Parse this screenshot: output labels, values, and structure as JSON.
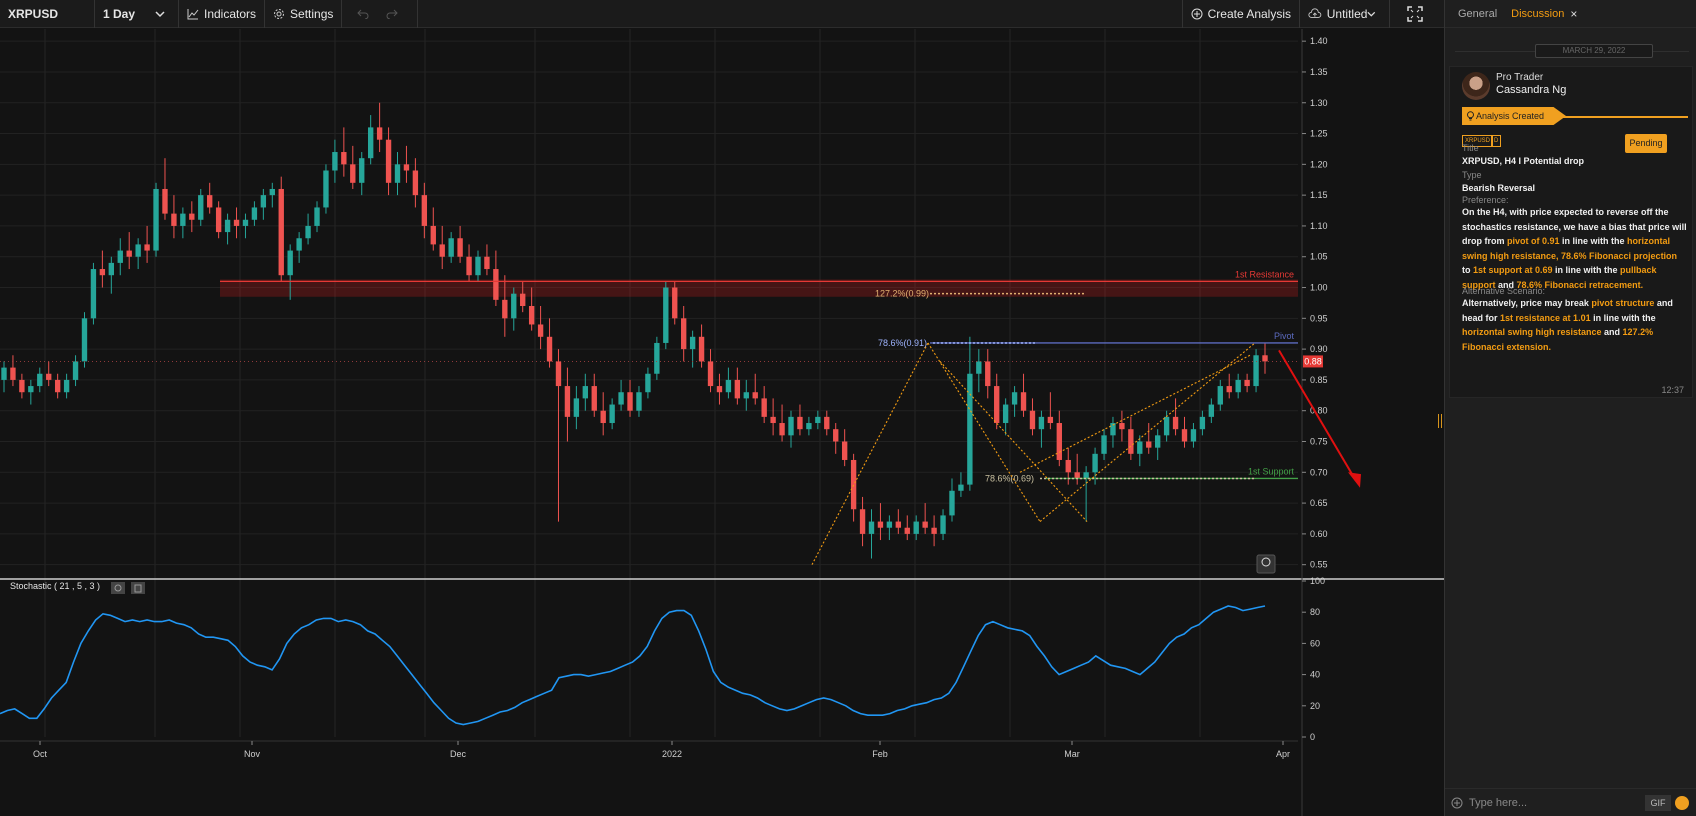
{
  "toolbar": {
    "symbol": "XRPUSD",
    "interval": "1 Day",
    "indicators_label": "Indicators",
    "settings_label": "Settings",
    "create_analysis_label": "Create Analysis",
    "layout_name": "Untitled"
  },
  "panel": {
    "tabs": [
      "General",
      "Discussion"
    ],
    "active_tab": "Discussion",
    "date_separator": "MARCH 29, 2022",
    "message": {
      "role": "Pro Trader",
      "author": "Cassandra Ng",
      "status": "Analysis Created",
      "tags": [
        "XRPUSD",
        "D"
      ],
      "badge": "Pending",
      "title_label": "Title",
      "title": "XRPUSD, H4 I Potential drop",
      "type_label": "Type",
      "type": "Bearish Reversal",
      "preference_label": "Preference:",
      "preference": [
        {
          "t": "On the H4, with price expected to reverse off the stochastics resistance, we have a bias that price will drop from ",
          "h": false
        },
        {
          "t": "pivot of 0.91",
          "h": true
        },
        {
          "t": " in line with the ",
          "h": false
        },
        {
          "t": "horizontal swing high resistance, 78.6% Fibonacci projection",
          "h": true
        },
        {
          "t": " to ",
          "h": false
        },
        {
          "t": "1st support at 0.69",
          "h": true
        },
        {
          "t": " in line with the ",
          "h": false
        },
        {
          "t": "pullback support",
          "h": true
        },
        {
          "t": " and ",
          "h": false
        },
        {
          "t": "78.6% Fibonacci retracement.",
          "h": true
        }
      ],
      "alternative_label": "Alternative Scenario:",
      "alternative": [
        {
          "t": "Alternatively, price may break ",
          "h": false
        },
        {
          "t": "pivot structure",
          "h": true
        },
        {
          "t": " and head for ",
          "h": false
        },
        {
          "t": "1st resistance at 1.01",
          "h": true
        },
        {
          "t": " in line with the ",
          "h": false
        },
        {
          "t": "horizontal swing high resistance",
          "h": true
        },
        {
          "t": " and ",
          "h": false
        },
        {
          "t": "127.2% Fibonacci extension.",
          "h": true
        }
      ],
      "time": "12:37"
    },
    "input_placeholder": "Type here...",
    "gif_label": "GIF"
  },
  "chart_data": [
    {
      "type": "candlestick",
      "symbol": "XRPUSD",
      "ylim": [
        0.53,
        1.41
      ],
      "yticks": [
        1.4,
        1.35,
        1.3,
        1.25,
        1.2,
        1.15,
        1.1,
        1.05,
        1.0,
        0.95,
        0.9,
        0.85,
        0.8,
        0.75,
        0.7,
        0.65,
        0.6,
        0.55
      ],
      "xticks": [
        "Oct",
        "Nov",
        "Dec",
        "2022",
        "Feb",
        "Mar",
        "Apr"
      ],
      "current_price": "0.88",
      "levels": [
        {
          "name": "1st Resistance",
          "value": 1.01,
          "color": "#e53935"
        },
        {
          "name": "Pivot",
          "value": 0.91,
          "color": "#5c6bc0"
        },
        {
          "name": "1st Support",
          "value": 0.69,
          "color": "#43a047"
        }
      ],
      "fib_labels": [
        {
          "text": "127.2%(0.99)",
          "value": 0.99
        },
        {
          "text": "78.6%(0.91)",
          "value": 0.91
        },
        {
          "text": "78.6%(0.69)",
          "value": 0.69
        }
      ],
      "candles": [
        [
          0.85,
          0.88,
          0.83,
          0.87
        ],
        [
          0.87,
          0.89,
          0.84,
          0.85
        ],
        [
          0.85,
          0.86,
          0.82,
          0.83
        ],
        [
          0.83,
          0.85,
          0.81,
          0.84
        ],
        [
          0.84,
          0.87,
          0.83,
          0.86
        ],
        [
          0.86,
          0.88,
          0.84,
          0.85
        ],
        [
          0.85,
          0.86,
          0.82,
          0.83
        ],
        [
          0.83,
          0.86,
          0.82,
          0.85
        ],
        [
          0.85,
          0.89,
          0.84,
          0.88
        ],
        [
          0.88,
          0.96,
          0.87,
          0.95
        ],
        [
          0.95,
          1.04,
          0.94,
          1.03
        ],
        [
          1.03,
          1.06,
          1.0,
          1.02
        ],
        [
          1.02,
          1.05,
          0.99,
          1.04
        ],
        [
          1.04,
          1.08,
          1.02,
          1.06
        ],
        [
          1.06,
          1.09,
          1.03,
          1.05
        ],
        [
          1.05,
          1.08,
          1.03,
          1.07
        ],
        [
          1.07,
          1.1,
          1.04,
          1.06
        ],
        [
          1.06,
          1.17,
          1.05,
          1.16
        ],
        [
          1.16,
          1.21,
          1.11,
          1.12
        ],
        [
          1.12,
          1.15,
          1.08,
          1.1
        ],
        [
          1.1,
          1.13,
          1.08,
          1.12
        ],
        [
          1.12,
          1.14,
          1.09,
          1.11
        ],
        [
          1.11,
          1.16,
          1.1,
          1.15
        ],
        [
          1.15,
          1.17,
          1.12,
          1.13
        ],
        [
          1.13,
          1.14,
          1.08,
          1.09
        ],
        [
          1.09,
          1.12,
          1.07,
          1.11
        ],
        [
          1.11,
          1.13,
          1.08,
          1.1
        ],
        [
          1.1,
          1.12,
          1.08,
          1.11
        ],
        [
          1.11,
          1.14,
          1.1,
          1.13
        ],
        [
          1.13,
          1.16,
          1.11,
          1.15
        ],
        [
          1.15,
          1.17,
          1.13,
          1.16
        ],
        [
          1.16,
          1.18,
          1.01,
          1.02
        ],
        [
          1.02,
          1.07,
          0.98,
          1.06
        ],
        [
          1.06,
          1.09,
          1.04,
          1.08
        ],
        [
          1.08,
          1.12,
          1.07,
          1.1
        ],
        [
          1.1,
          1.14,
          1.09,
          1.13
        ],
        [
          1.13,
          1.2,
          1.12,
          1.19
        ],
        [
          1.19,
          1.24,
          1.17,
          1.22
        ],
        [
          1.22,
          1.26,
          1.18,
          1.2
        ],
        [
          1.2,
          1.23,
          1.16,
          1.17
        ],
        [
          1.17,
          1.22,
          1.15,
          1.21
        ],
        [
          1.21,
          1.28,
          1.2,
          1.26
        ],
        [
          1.26,
          1.3,
          1.22,
          1.24
        ],
        [
          1.24,
          1.26,
          1.15,
          1.17
        ],
        [
          1.17,
          1.22,
          1.15,
          1.2
        ],
        [
          1.2,
          1.23,
          1.17,
          1.19
        ],
        [
          1.19,
          1.21,
          1.13,
          1.15
        ],
        [
          1.15,
          1.17,
          1.08,
          1.1
        ],
        [
          1.1,
          1.13,
          1.06,
          1.07
        ],
        [
          1.07,
          1.1,
          1.03,
          1.05
        ],
        [
          1.05,
          1.09,
          1.04,
          1.08
        ],
        [
          1.08,
          1.1,
          1.04,
          1.05
        ],
        [
          1.05,
          1.07,
          1.01,
          1.02
        ],
        [
          1.02,
          1.06,
          1.01,
          1.05
        ],
        [
          1.05,
          1.07,
          1.02,
          1.03
        ],
        [
          1.03,
          1.06,
          0.97,
          0.98
        ],
        [
          0.98,
          1.02,
          0.92,
          0.95
        ],
        [
          0.95,
          1.0,
          0.93,
          0.99
        ],
        [
          0.99,
          1.01,
          0.96,
          0.97
        ],
        [
          0.97,
          1.0,
          0.93,
          0.94
        ],
        [
          0.94,
          0.97,
          0.9,
          0.92
        ],
        [
          0.92,
          0.95,
          0.87,
          0.88
        ],
        [
          0.88,
          0.9,
          0.62,
          0.84
        ],
        [
          0.84,
          0.87,
          0.75,
          0.79
        ],
        [
          0.79,
          0.84,
          0.77,
          0.82
        ],
        [
          0.82,
          0.86,
          0.8,
          0.84
        ],
        [
          0.84,
          0.86,
          0.79,
          0.8
        ],
        [
          0.8,
          0.83,
          0.76,
          0.78
        ],
        [
          0.78,
          0.82,
          0.77,
          0.81
        ],
        [
          0.81,
          0.85,
          0.8,
          0.83
        ],
        [
          0.83,
          0.85,
          0.79,
          0.8
        ],
        [
          0.8,
          0.84,
          0.79,
          0.83
        ],
        [
          0.83,
          0.87,
          0.82,
          0.86
        ],
        [
          0.86,
          0.92,
          0.85,
          0.91
        ],
        [
          0.91,
          1.01,
          0.9,
          1.0
        ],
        [
          1.0,
          1.01,
          0.94,
          0.95
        ],
        [
          0.95,
          0.97,
          0.88,
          0.9
        ],
        [
          0.9,
          0.93,
          0.87,
          0.92
        ],
        [
          0.92,
          0.94,
          0.87,
          0.88
        ],
        [
          0.88,
          0.9,
          0.83,
          0.84
        ],
        [
          0.84,
          0.86,
          0.81,
          0.83
        ],
        [
          0.83,
          0.87,
          0.82,
          0.85
        ],
        [
          0.85,
          0.87,
          0.81,
          0.82
        ],
        [
          0.82,
          0.85,
          0.8,
          0.83
        ],
        [
          0.83,
          0.86,
          0.81,
          0.82
        ],
        [
          0.82,
          0.84,
          0.78,
          0.79
        ],
        [
          0.79,
          0.82,
          0.76,
          0.78
        ],
        [
          0.78,
          0.81,
          0.75,
          0.76
        ],
        [
          0.76,
          0.8,
          0.74,
          0.79
        ],
        [
          0.79,
          0.81,
          0.76,
          0.77
        ],
        [
          0.77,
          0.79,
          0.76,
          0.78
        ],
        [
          0.78,
          0.8,
          0.77,
          0.79
        ],
        [
          0.79,
          0.8,
          0.76,
          0.77
        ],
        [
          0.77,
          0.78,
          0.73,
          0.75
        ],
        [
          0.75,
          0.77,
          0.71,
          0.72
        ],
        [
          0.72,
          0.73,
          0.62,
          0.64
        ],
        [
          0.64,
          0.66,
          0.58,
          0.6
        ],
        [
          0.6,
          0.64,
          0.56,
          0.62
        ],
        [
          0.62,
          0.65,
          0.59,
          0.61
        ],
        [
          0.61,
          0.63,
          0.59,
          0.62
        ],
        [
          0.62,
          0.64,
          0.6,
          0.61
        ],
        [
          0.61,
          0.63,
          0.59,
          0.6
        ],
        [
          0.6,
          0.63,
          0.59,
          0.62
        ],
        [
          0.62,
          0.65,
          0.6,
          0.61
        ],
        [
          0.61,
          0.63,
          0.58,
          0.6
        ],
        [
          0.6,
          0.64,
          0.59,
          0.63
        ],
        [
          0.63,
          0.69,
          0.62,
          0.67
        ],
        [
          0.67,
          0.7,
          0.66,
          0.68
        ],
        [
          0.68,
          0.92,
          0.67,
          0.86
        ],
        [
          0.86,
          0.9,
          0.83,
          0.88
        ],
        [
          0.88,
          0.9,
          0.82,
          0.84
        ],
        [
          0.84,
          0.86,
          0.77,
          0.78
        ],
        [
          0.78,
          0.82,
          0.76,
          0.81
        ],
        [
          0.81,
          0.84,
          0.79,
          0.83
        ],
        [
          0.83,
          0.86,
          0.79,
          0.8
        ],
        [
          0.8,
          0.82,
          0.76,
          0.77
        ],
        [
          0.77,
          0.8,
          0.74,
          0.79
        ],
        [
          0.79,
          0.83,
          0.77,
          0.78
        ],
        [
          0.78,
          0.8,
          0.71,
          0.72
        ],
        [
          0.72,
          0.74,
          0.68,
          0.7
        ],
        [
          0.7,
          0.73,
          0.68,
          0.69
        ],
        [
          0.69,
          0.71,
          0.62,
          0.7
        ],
        [
          0.7,
          0.74,
          0.68,
          0.73
        ],
        [
          0.73,
          0.77,
          0.72,
          0.76
        ],
        [
          0.76,
          0.79,
          0.74,
          0.78
        ],
        [
          0.78,
          0.8,
          0.75,
          0.77
        ],
        [
          0.77,
          0.79,
          0.72,
          0.73
        ],
        [
          0.73,
          0.76,
          0.71,
          0.75
        ],
        [
          0.75,
          0.78,
          0.73,
          0.74
        ],
        [
          0.74,
          0.77,
          0.72,
          0.76
        ],
        [
          0.76,
          0.8,
          0.75,
          0.79
        ],
        [
          0.79,
          0.82,
          0.76,
          0.77
        ],
        [
          0.77,
          0.79,
          0.74,
          0.75
        ],
        [
          0.75,
          0.78,
          0.74,
          0.77
        ],
        [
          0.77,
          0.8,
          0.76,
          0.79
        ],
        [
          0.79,
          0.82,
          0.78,
          0.81
        ],
        [
          0.81,
          0.85,
          0.8,
          0.84
        ],
        [
          0.84,
          0.86,
          0.82,
          0.83
        ],
        [
          0.83,
          0.86,
          0.82,
          0.85
        ],
        [
          0.85,
          0.86,
          0.83,
          0.84
        ],
        [
          0.84,
          0.9,
          0.83,
          0.89
        ],
        [
          0.89,
          0.91,
          0.86,
          0.88
        ]
      ]
    },
    {
      "type": "line",
      "title": "Stochastic ( 21 , 5 , 3 )",
      "ylim": [
        0,
        100
      ],
      "yticks": [
        100,
        80,
        60,
        40,
        20,
        0
      ],
      "values": [
        15,
        17,
        18,
        15,
        12,
        12,
        18,
        25,
        30,
        35,
        48,
        60,
        68,
        75,
        79,
        78,
        76,
        74,
        75,
        74,
        75,
        74,
        74,
        75,
        73,
        72,
        70,
        66,
        64,
        64,
        63,
        62,
        58,
        52,
        48,
        46,
        45,
        43,
        50,
        60,
        66,
        70,
        72,
        75,
        76,
        76,
        74,
        75,
        74,
        72,
        68,
        66,
        62,
        58,
        52,
        46,
        40,
        34,
        28,
        22,
        17,
        12,
        9,
        8,
        9,
        10,
        12,
        14,
        16,
        17,
        19,
        22,
        24,
        26,
        28,
        30,
        38,
        39,
        40,
        40,
        39,
        40,
        41,
        42,
        44,
        46,
        48,
        52,
        58,
        68,
        76,
        80,
        81,
        81,
        78,
        68,
        56,
        42,
        35,
        32,
        30,
        28,
        27,
        25,
        22,
        20,
        18,
        17,
        18,
        20,
        22,
        24,
        25,
        24,
        22,
        20,
        17,
        15,
        14,
        14,
        14,
        15,
        17,
        18,
        20,
        21,
        22,
        24,
        25,
        28,
        35,
        45,
        55,
        65,
        72,
        74,
        72,
        70,
        69,
        68,
        65,
        58,
        52,
        45,
        40,
        42,
        44,
        46,
        48,
        52,
        49,
        46,
        45,
        44,
        42,
        40,
        44,
        48,
        54,
        60,
        64,
        66,
        70,
        72,
        76,
        80,
        82,
        84,
        83,
        81,
        82,
        83,
        84
      ]
    }
  ]
}
